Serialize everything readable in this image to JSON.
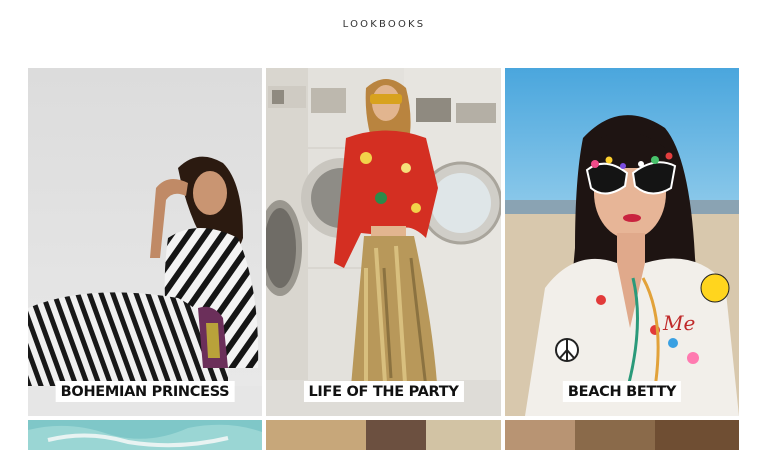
{
  "page": {
    "title": "LOOKBOOKS"
  },
  "lookbooks": [
    {
      "label": "BOHEMIAN PRINCESS"
    },
    {
      "label": "LIFE OF THE PARTY"
    },
    {
      "label": "BEACH BETTY",
      "badge_text": "Me"
    }
  ],
  "colors": {
    "background": "#ffffff",
    "title": "#333333",
    "label_bg": "#ffffff",
    "label_text": "#111111"
  }
}
